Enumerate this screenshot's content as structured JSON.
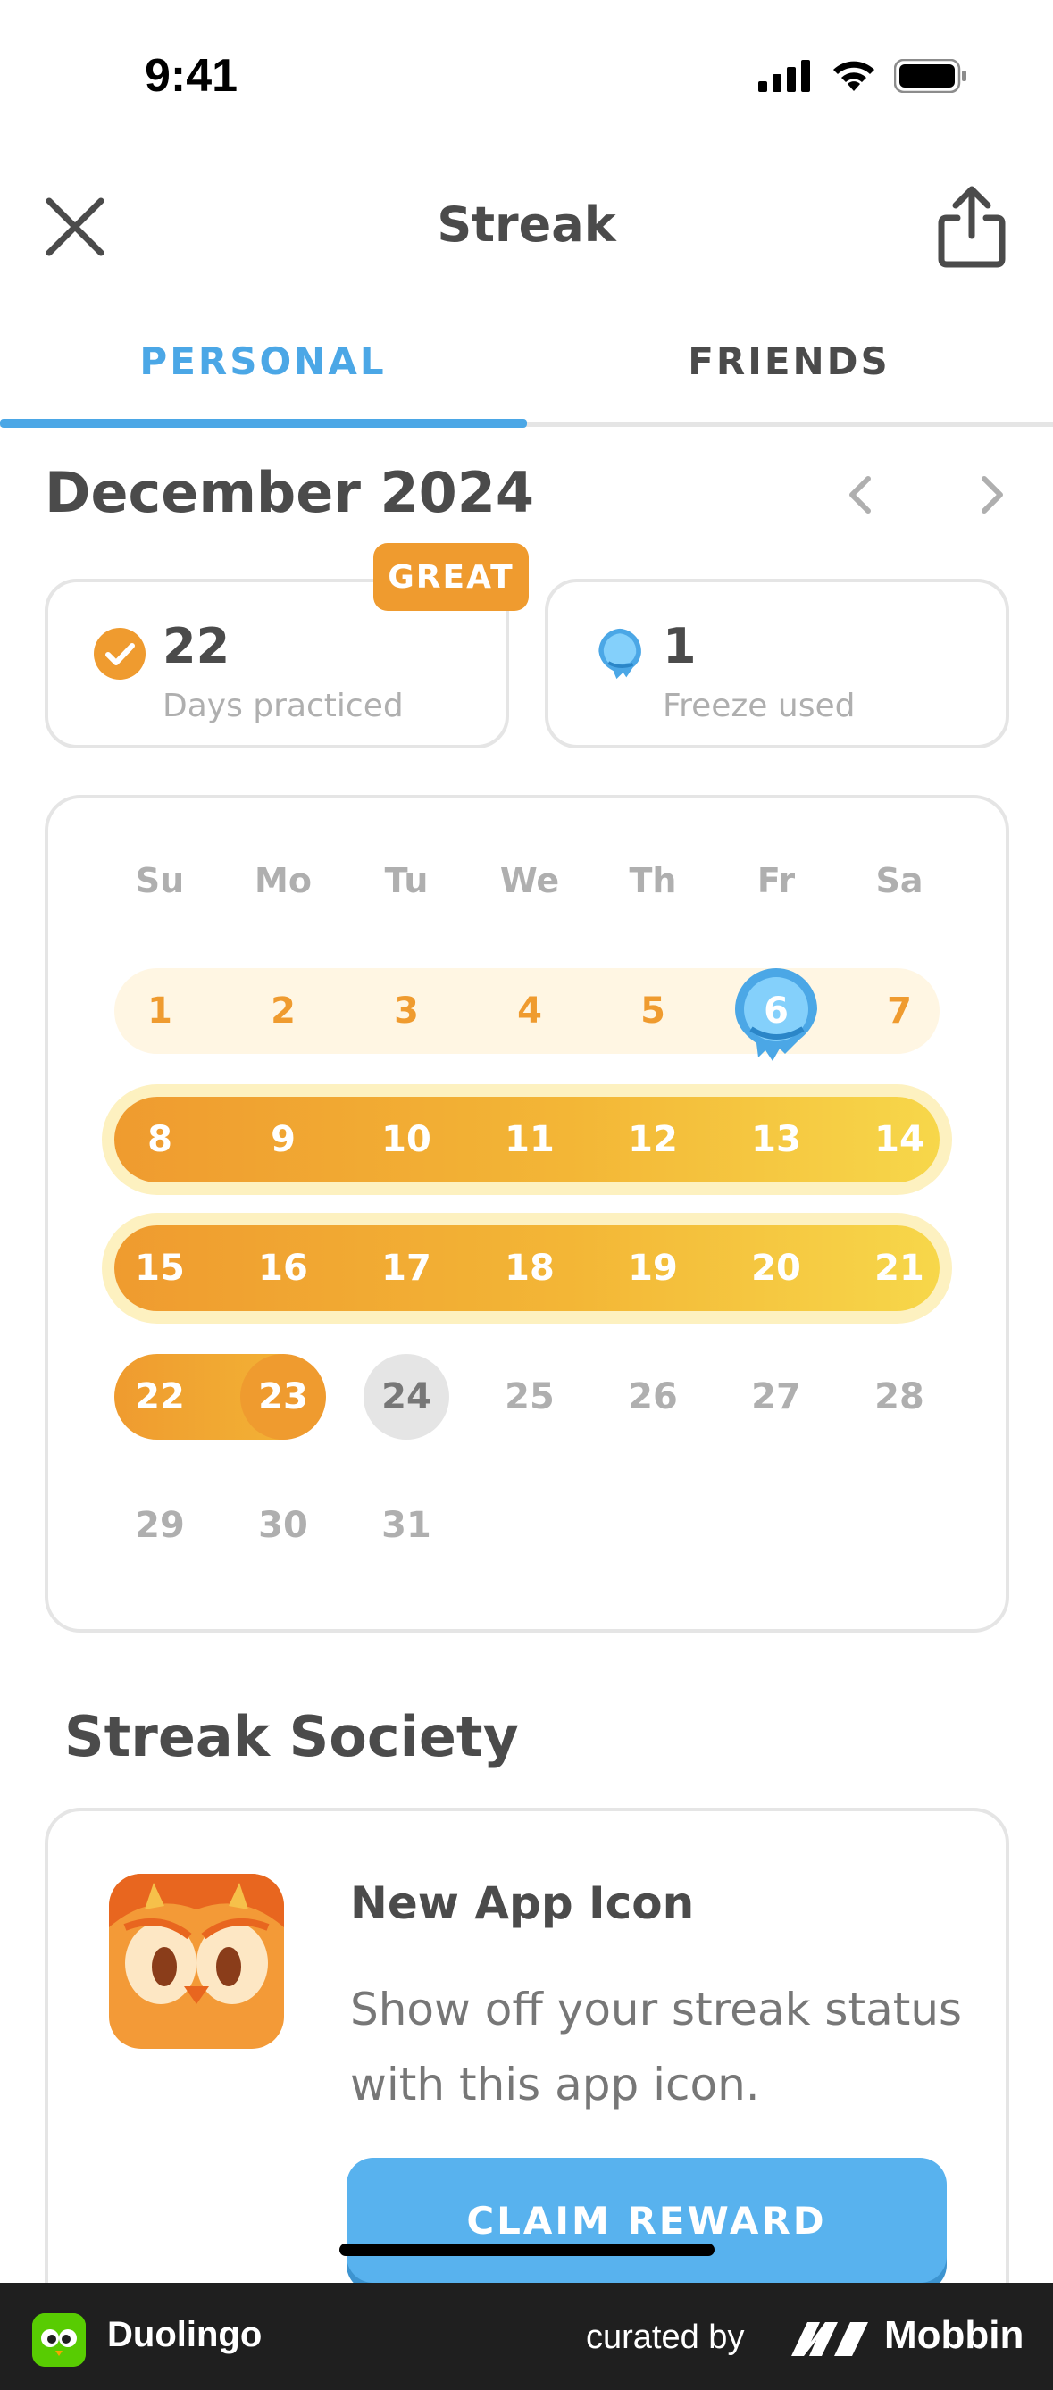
{
  "status_bar": {
    "time": "9:41"
  },
  "header": {
    "title": "Streak"
  },
  "tabs": [
    {
      "label": "PERSONAL",
      "active": true
    },
    {
      "label": "FRIENDS",
      "active": false
    }
  ],
  "calendar_header": {
    "month_label": "December 2024"
  },
  "stats": {
    "badge": "GREAT",
    "days_practiced": {
      "value": "22",
      "label": "Days practiced",
      "icon": "check-circle-icon"
    },
    "freezes": {
      "value": "1",
      "label": "Freeze used",
      "icon": "freeze-icon"
    }
  },
  "calendar": {
    "weekdays": [
      "Su",
      "Mo",
      "Tu",
      "We",
      "Th",
      "Fr",
      "Sa"
    ],
    "weeks": [
      [
        "1",
        "2",
        "3",
        "4",
        "5",
        "6",
        "7"
      ],
      [
        "8",
        "9",
        "10",
        "11",
        "12",
        "13",
        "14"
      ],
      [
        "15",
        "16",
        "17",
        "18",
        "19",
        "20",
        "21"
      ],
      [
        "22",
        "23",
        "24",
        "25",
        "26",
        "27",
        "28"
      ],
      [
        "29",
        "30",
        "31"
      ]
    ],
    "today": "24",
    "freeze_day": "6"
  },
  "society": {
    "title": "Streak Society",
    "reward": {
      "title": "New App Icon",
      "description": "Show off your streak status with this app icon.",
      "button": "CLAIM REWARD"
    }
  },
  "footer": {
    "app_name": "Duolingo",
    "curated_by": "curated by",
    "brand": "Mobbin"
  },
  "colors": {
    "accent_blue": "#4ba7e6",
    "streak_orange": "#ef9b2f",
    "streak_yellow": "#f7d74a",
    "button_blue": "#58b2ee"
  }
}
